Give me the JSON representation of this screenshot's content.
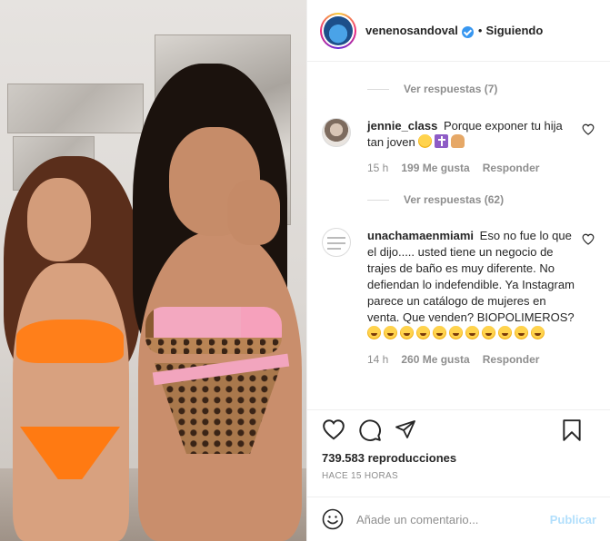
{
  "post": {
    "username": "venenosandoval",
    "separator": "•",
    "follow_status": "Siguiendo"
  },
  "comments": {
    "truncated_line": "— ——— —",
    "replies_1": "Ver respuestas (7)",
    "replies_2": "Ver respuestas (62)",
    "items": [
      {
        "user": "jennie_class",
        "text": "Porque exponer tu hija tan joven",
        "emojis": [
          "sad-face-emoji",
          "latin-cross-emoji",
          "folded-hands-emoji"
        ],
        "time": "15 h",
        "likes": "199 Me gusta",
        "reply": "Responder"
      },
      {
        "user": "unachamaenmiami",
        "text": "Eso no fue lo que el dijo..... usted tiene un negocio de trajes de baño es muy diferente. No defiendan lo indefendible. Ya Instagram parece un catálogo de mujeres en venta. Que venden? BIOPOLIMEROS?",
        "emoji_count": 11,
        "time": "14 h",
        "likes": "260 Me gusta",
        "reply": "Responder"
      }
    ]
  },
  "stats": {
    "views": "739.583 reproducciones",
    "time_ago": "HACE 15 HORAS"
  },
  "composer": {
    "placeholder": "Añade un comentario...",
    "publish_label": "Publicar"
  },
  "colors": {
    "verified": "#3897f0",
    "muted": "#8e8e8e",
    "publish_disabled": "#b2dffc"
  }
}
